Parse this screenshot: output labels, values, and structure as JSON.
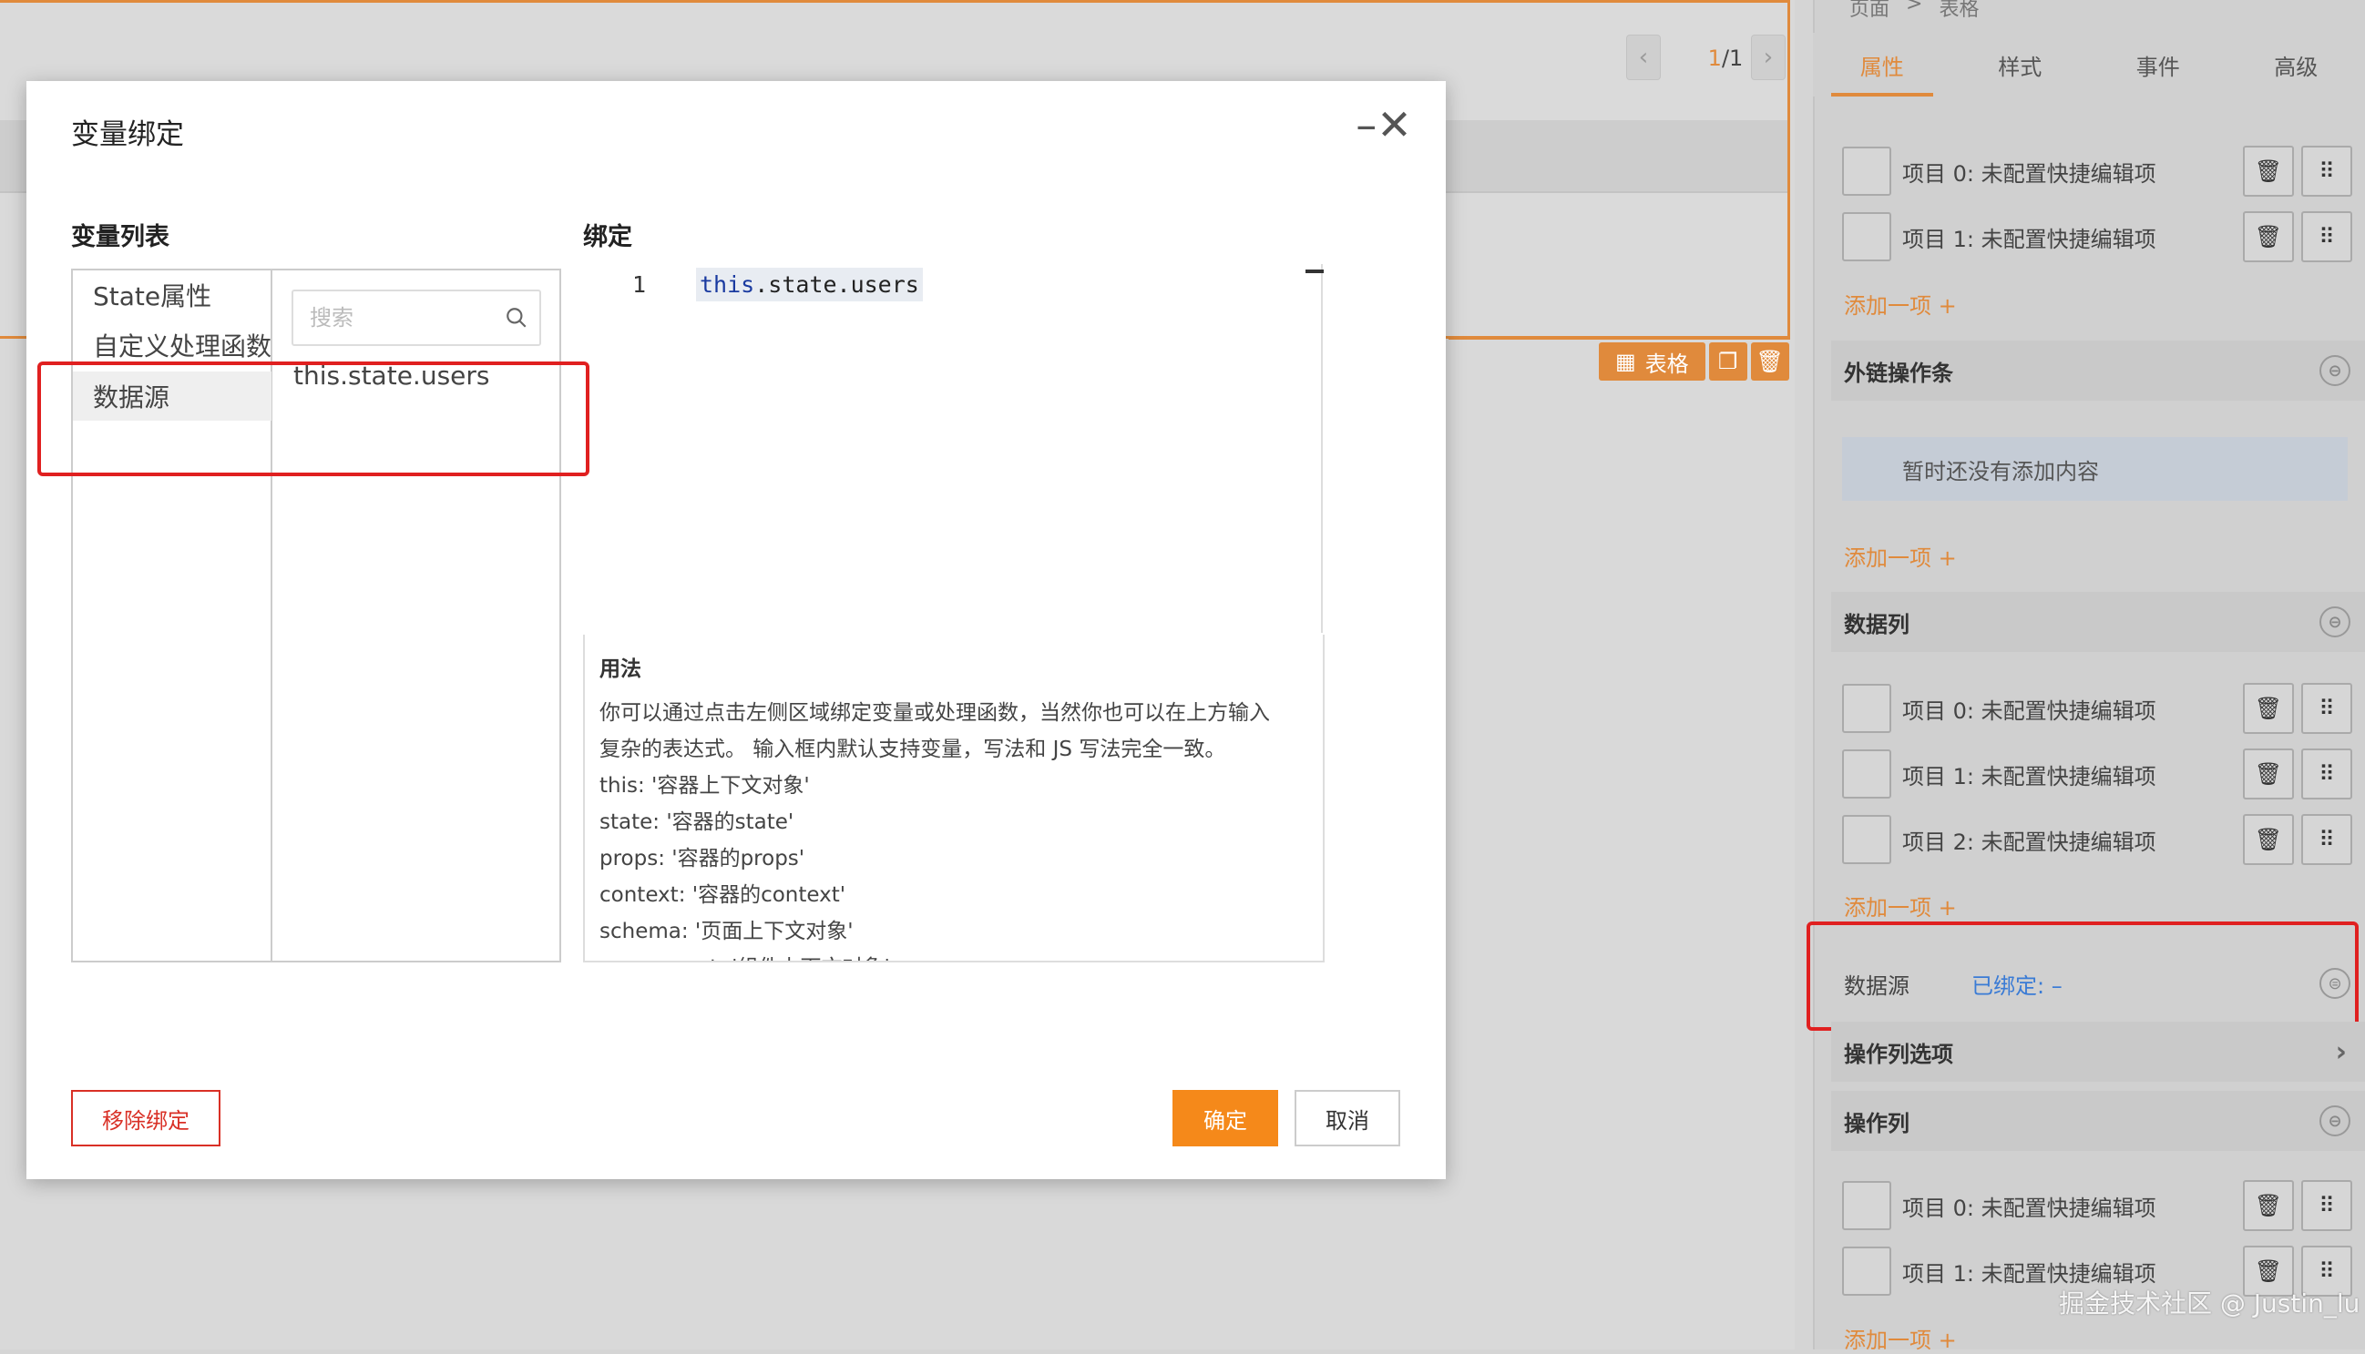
{
  "canvas": {
    "pager": {
      "current": "1",
      "total": "/1",
      "prev_icon": "chevron-left-icon",
      "next_icon": "chevron-right-icon"
    },
    "selection_toolbar": {
      "tag_label": "表格",
      "tag_icon": "table-icon",
      "copy_icon": "copy-icon",
      "delete_icon": "trash-icon"
    },
    "accent_color": "#e08a3c"
  },
  "panel": {
    "breadcrumb": [
      "页面",
      ">",
      "表格"
    ],
    "tabs": [
      "属性",
      "样式",
      "事件",
      "高级"
    ],
    "active_tab": "属性",
    "group1": {
      "items": [
        "项目 0:  未配置快捷编辑项",
        "项目 1:  未配置快捷编辑项"
      ],
      "add_label": "添加一项 +"
    },
    "external_ops": {
      "title": "外链操作条",
      "empty_text": "暂时还没有添加内容",
      "add_label": "添加一项 +"
    },
    "data_columns": {
      "title": "数据列",
      "items": [
        "项目 0:  未配置快捷编辑项",
        "项目 1:  未配置快捷编辑项",
        "项目 2:  未配置快捷编辑项"
      ],
      "add_label": "添加一项 +"
    },
    "datasource": {
      "label": "数据源",
      "bound_text": "已绑定: –"
    },
    "op_column_options": {
      "title": "操作列选项"
    },
    "op_column": {
      "title": "操作列",
      "items": [
        "项目 0:  未配置快捷编辑项",
        "项目 1:  未配置快捷编辑项"
      ],
      "add_label": "添加一项 +"
    },
    "watermark": "掘金技术社区 @ Justin_lu"
  },
  "modal": {
    "title": "变量绑定",
    "var_list_title": "变量列表",
    "bind_title": "绑定",
    "categories": [
      "State属性",
      "自定义处理函数",
      "数据源"
    ],
    "active_category": "数据源",
    "search_placeholder": "搜索",
    "variables": [
      "this.state.users"
    ],
    "editor": {
      "line_number": "1",
      "code_keyword": "this",
      "code_rest": ".state.users"
    },
    "usage": {
      "title": "用法",
      "lines": [
        "你可以通过点击左侧区域绑定变量或处理函数，当然你也可以在上方输入",
        "复杂的表达式。 输入框内默认支持变量，写法和 JS 写法完全一致。",
        "this: '容器上下文对象'",
        "state: '容器的state'",
        "props: '容器的props'",
        "context: '容器的context'",
        "schema: '页面上下文对象'",
        "component: '组件上下文对象'"
      ]
    },
    "buttons": {
      "unbind": "移除绑定",
      "ok": "确定",
      "cancel": "取消"
    },
    "colors": {
      "primary": "#f5891a",
      "danger": "#d93026",
      "highlight": "#e02020"
    }
  }
}
